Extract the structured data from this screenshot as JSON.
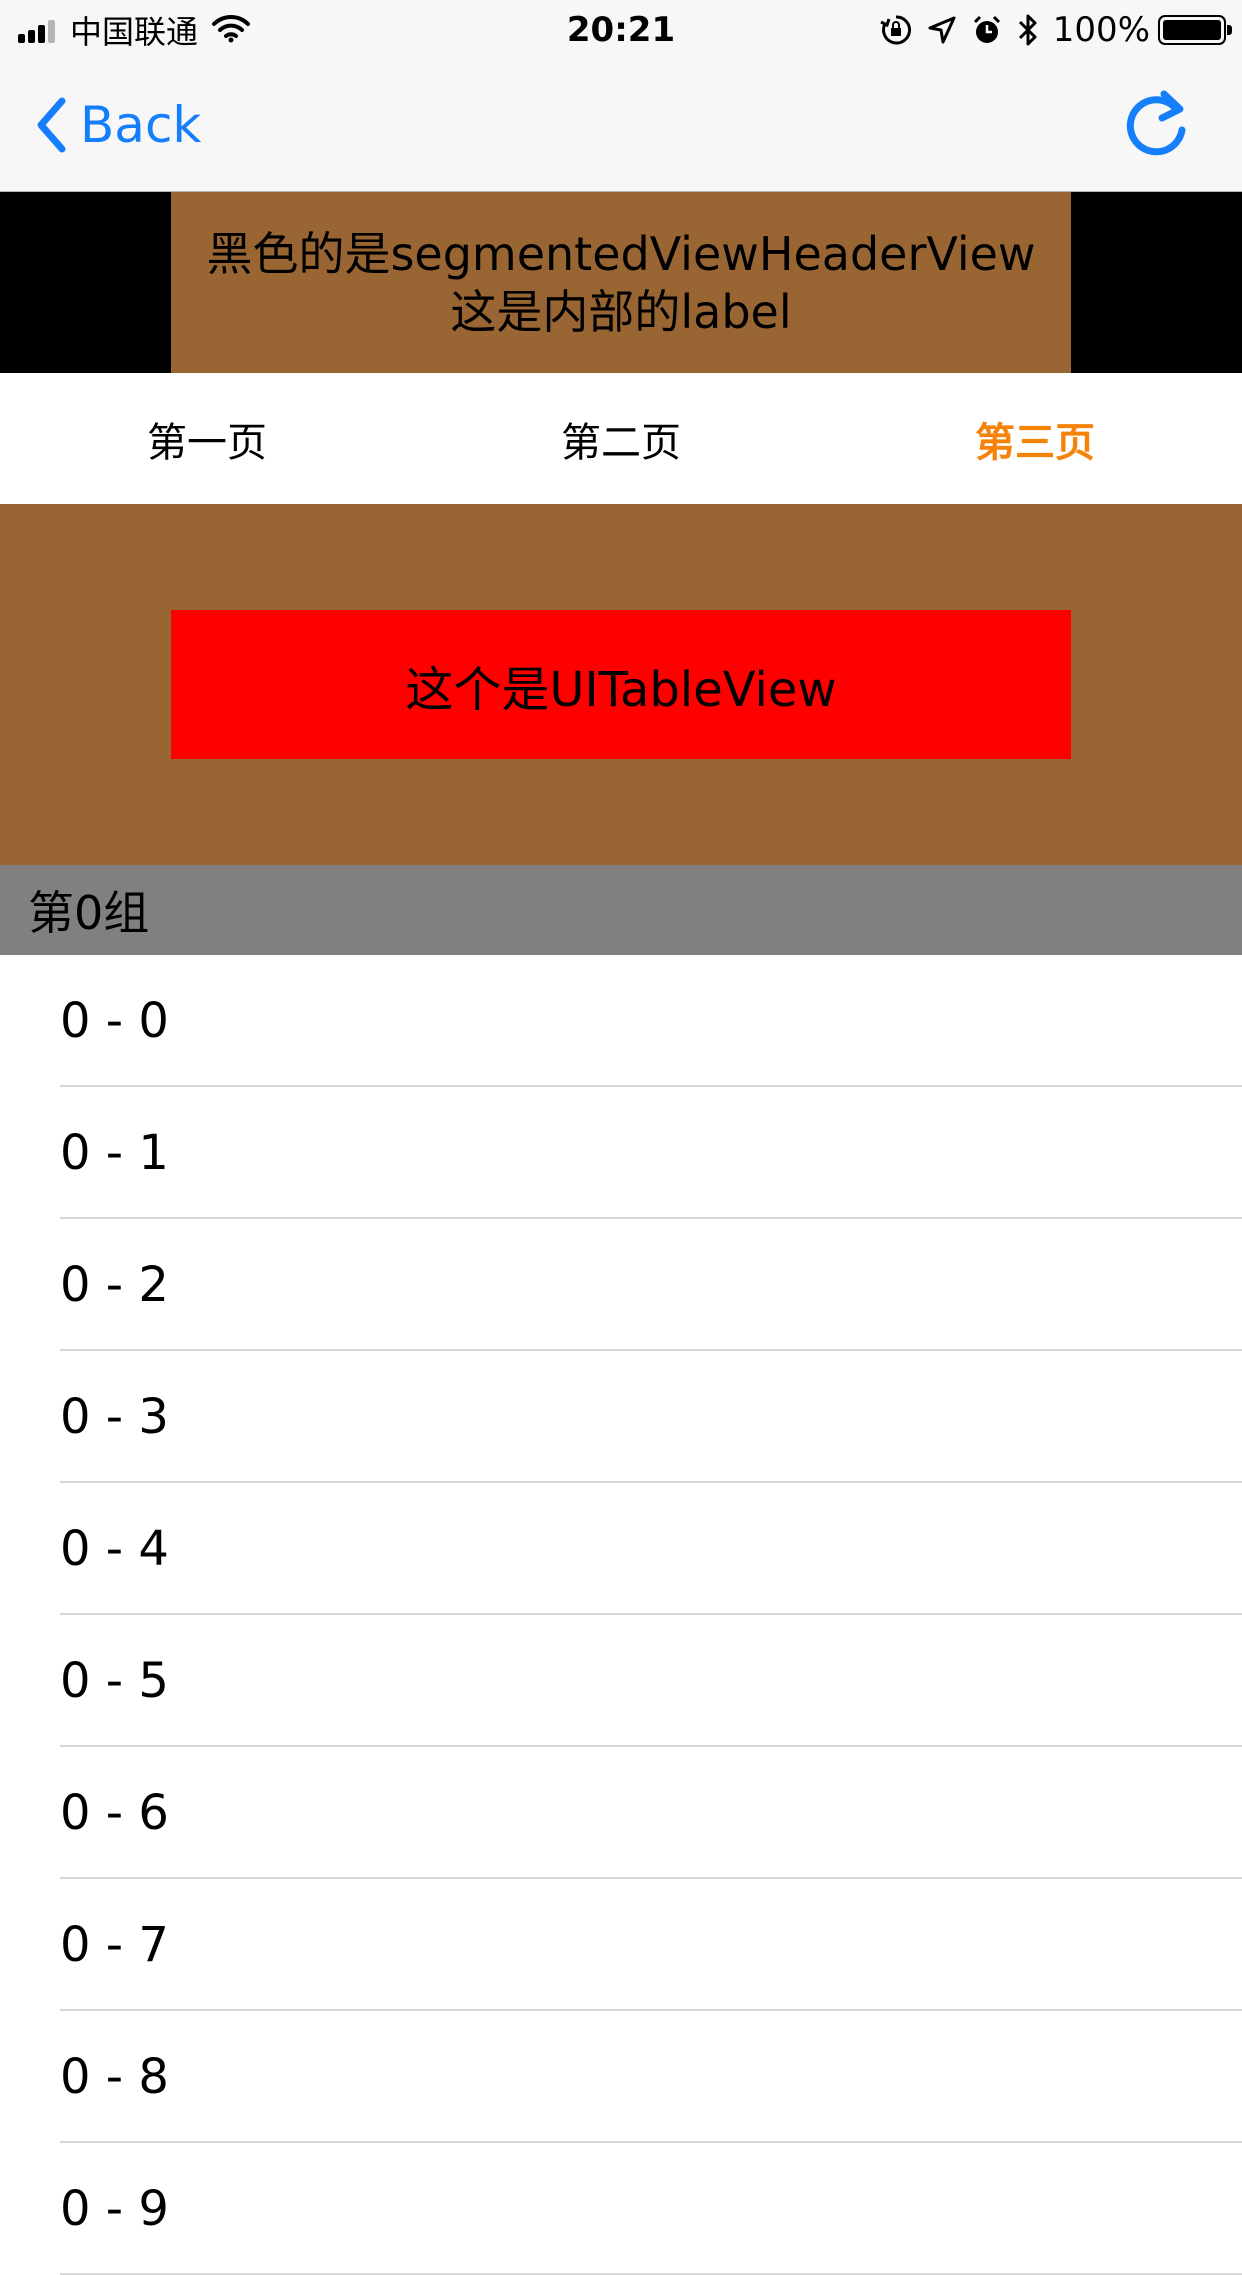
{
  "status_bar": {
    "carrier": "中国联通",
    "time": "20:21",
    "battery": "100%",
    "icons": [
      "signal-icon",
      "wifi-icon",
      "orientation-lock-icon",
      "location-icon",
      "alarm-icon",
      "bluetooth-icon",
      "battery-icon"
    ]
  },
  "nav": {
    "back_label": "Back",
    "accent_color": "#147efb",
    "icons": [
      "chevron-left-icon",
      "refresh-icon"
    ]
  },
  "header_view": {
    "line1": "黑色的是segmentedViewHeaderView",
    "line2": "这是内部的label",
    "background": "#000000",
    "label_background": "#996633"
  },
  "segments": {
    "tabs": [
      {
        "label": "第一页"
      },
      {
        "label": "第二页"
      },
      {
        "label": "第三页"
      }
    ],
    "selected_index": 2,
    "selected_color": "#f5830a"
  },
  "table_header": {
    "label": "这个是UITableView",
    "background": "#996633",
    "label_background": "#ff0000"
  },
  "section": {
    "title": "第0组",
    "background": "#808080",
    "rows": [
      "0 - 0",
      "0 - 1",
      "0 - 2",
      "0 - 3",
      "0 - 4",
      "0 - 5",
      "0 - 6",
      "0 - 7",
      "0 - 8",
      "0 - 9"
    ]
  }
}
